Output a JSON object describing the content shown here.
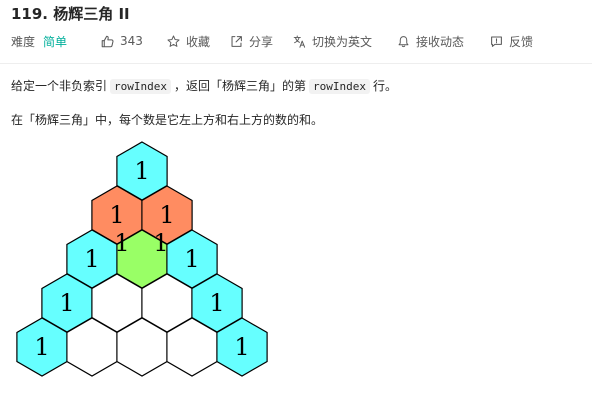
{
  "problem": {
    "title": "119. 杨辉三角 II"
  },
  "toolbar": {
    "difficulty_label": "难度",
    "difficulty_value": "简单",
    "like_count": "343",
    "collect_label": "收藏",
    "share_label": "分享",
    "switch_lang_label": "切换为英文",
    "follow_label": "接收动态",
    "feedback_label": "反馈",
    "icons": [
      "thumbs-up-icon",
      "star-icon",
      "share-icon",
      "translate-icon",
      "bell-icon",
      "feedback-icon"
    ],
    "difficulty_color": "#00af9b"
  },
  "description": {
    "p1_pre": "给定一个非负索引",
    "p1_code1": "rowIndex",
    "p1_mid": "，返回「杨辉三角」的第",
    "p1_code2": "rowIndex",
    "p1_post": "行。",
    "p2": "在「杨辉三角」中，每个数是它左上方和右上方的数的和。"
  },
  "figure": {
    "colors": {
      "cyan": "#66ffff",
      "orange": "#ff8c61",
      "green": "#99ff66",
      "white": "#ffffff"
    },
    "rows": [
      [
        {
          "text": "1",
          "color": "cyan"
        }
      ],
      [
        {
          "text": "1",
          "color": "orange"
        },
        {
          "text": "1",
          "color": "orange"
        }
      ],
      [
        {
          "text": "1",
          "color": "cyan"
        },
        {
          "text": "",
          "color": "green"
        },
        {
          "text": "1",
          "color": "cyan"
        }
      ],
      [
        {
          "text": "1",
          "color": "cyan"
        },
        {
          "text": "",
          "color": "white"
        },
        {
          "text": "",
          "color": "white"
        },
        {
          "text": "1",
          "color": "cyan"
        }
      ],
      [
        {
          "text": "1",
          "color": "cyan"
        },
        {
          "text": "",
          "color": "white"
        },
        {
          "text": "",
          "color": "white"
        },
        {
          "text": "",
          "color": "white"
        },
        {
          "text": "1",
          "color": "cyan"
        }
      ]
    ],
    "overlap_labels": [
      "1",
      "1"
    ]
  }
}
